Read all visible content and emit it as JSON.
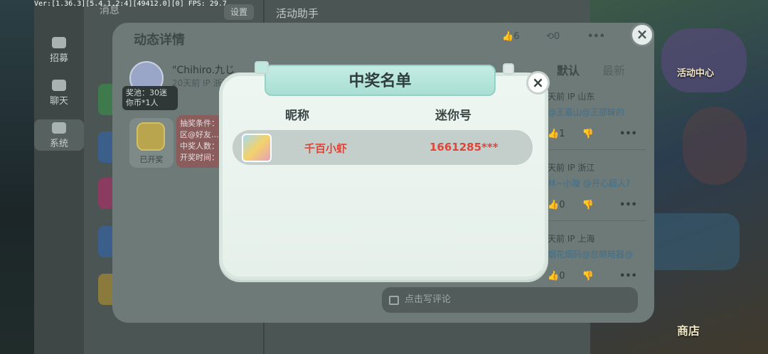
{
  "debug": {
    "fps_text": "Ver:[1.36.3][5.4.1.2:4][49412.0][0] FPS: 29.7"
  },
  "messages": {
    "header_left": "消息",
    "settings_label": "设置",
    "header_right": "活动助手",
    "nav": [
      {
        "label": "招募",
        "icon": "recruit-icon"
      },
      {
        "label": "聊天",
        "icon": "chat-icon"
      },
      {
        "label": "系统",
        "icon": "bell-icon"
      }
    ]
  },
  "detail": {
    "title": "动态详情",
    "likes": "6",
    "shares": "0",
    "more": "•••",
    "close": "×",
    "post": {
      "author": "\"Chihiro.九じ",
      "meta": "20天前 IP 浙江",
      "tag": "奖池：30迷你币*1人",
      "prize_status": "已开奖",
      "conditions": "抽奖条件：区@好友... 中奖人数：开奖时间："
    },
    "sort_tabs": [
      "默认",
      "最新"
    ],
    "comments": [
      {
        "meta": "天前 IP 山东",
        "text_a": "@王嘉山@王邵昧的",
        "likes": "1"
      },
      {
        "meta": "天前 IP 浙江",
        "text_a": "林~小璇 @开心超人?",
        "likes": "0"
      },
      {
        "meta": "天前 IP 上海",
        "text_a": "烟花烟码@忽萌暗器@",
        "likes": "0"
      }
    ],
    "comment_placeholder": "点击写评论"
  },
  "winner_modal": {
    "title": "中奖名单",
    "close": "×",
    "col_nickname": "昵称",
    "col_mini_id": "迷你号",
    "winners": [
      {
        "nickname": "千百小虾",
        "mini_id": "1661285***"
      }
    ]
  },
  "right_panel": {
    "labels": [
      "活动中心",
      "商店"
    ]
  },
  "colors": {
    "winner_text": "#e0453a",
    "modal_bg": "#eef6f2",
    "banner": "#c4ece4"
  }
}
